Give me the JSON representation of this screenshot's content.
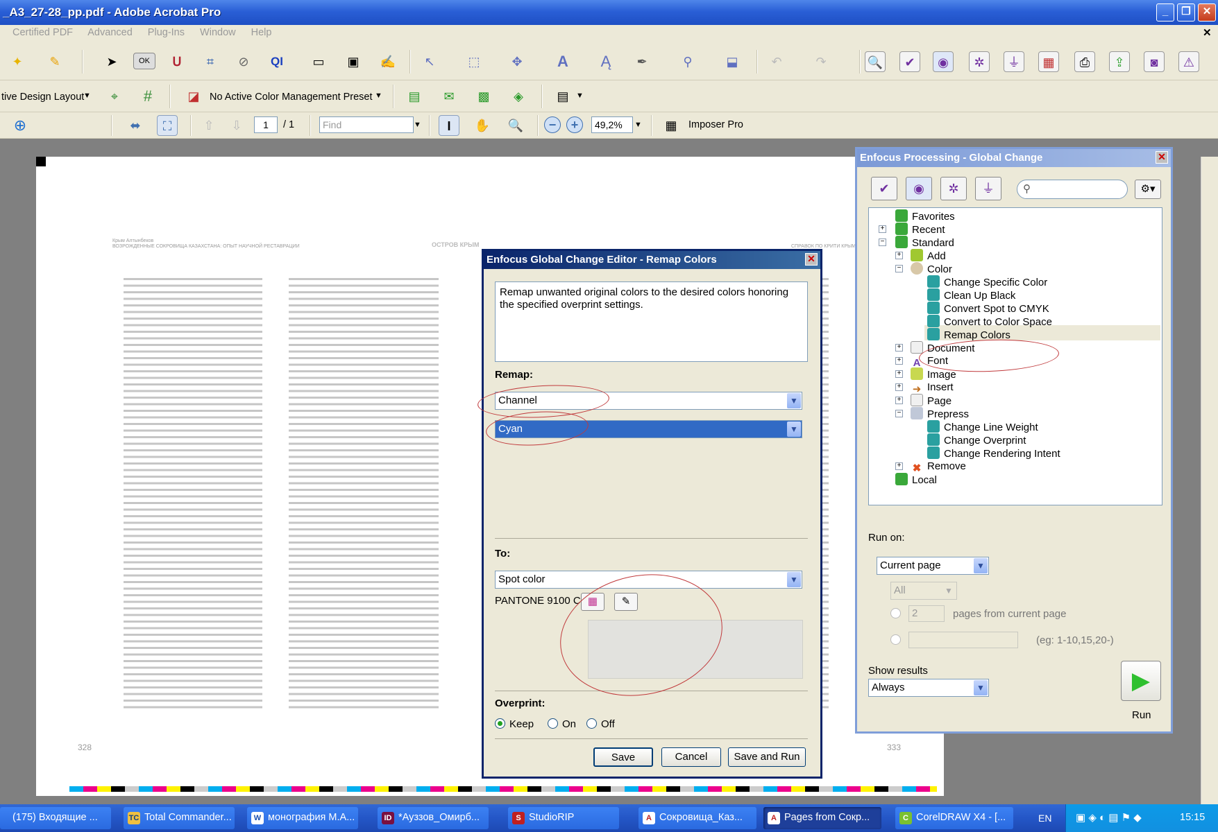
{
  "window": {
    "title": "_A3_27-28_pp.pdf - Adobe Acrobat Pro",
    "min": "_",
    "max": "❐",
    "close": "✕",
    "doc_close": "✕"
  },
  "menu": [
    "Certified PDF",
    "Advanced",
    "Plug-Ins",
    "Window",
    "Help"
  ],
  "toolbar2": {
    "design_layout": "tive Design Layout",
    "color_preset": "No Active Color Management Preset"
  },
  "toolbar3": {
    "page_value": "1",
    "page_total": "/ 1",
    "find_placeholder": "Find",
    "zoom": "49,2%",
    "imposer": "Imposer Pro"
  },
  "document": {
    "left_header_author": "Крым Алтынбеков",
    "left_header_title": "ВОЗРОЖДЕННЫЕ СОКРОВИЩА КАЗАХСТАНА: ОПЫТ НАУЧНОЙ РЕСТАВРАЦИИ",
    "logo_text": "ОСТРОВ КРЫМ",
    "right_header": "СПРАВОК ПО КРИТИ КРЫМУ",
    "page_left": "328",
    "page_right": "333"
  },
  "editor": {
    "title": "Enfocus Global Change Editor - Remap Colors",
    "description": "Remap unwanted original colors to the desired colors honoring the specified overprint settings.",
    "remap_label": "Remap:",
    "remap_mode": "Channel",
    "remap_channel": "Cyan",
    "to_label": "To:",
    "to_type": "Spot color",
    "spot_name": "PANTONE 9100 C",
    "overprint_label": "Overprint:",
    "overprint_options": [
      "Keep",
      "On",
      "Off"
    ],
    "save": "Save",
    "cancel": "Cancel",
    "save_run": "Save and Run"
  },
  "processing": {
    "title": "Enfocus Processing - Global Change",
    "tree": {
      "favorites": "Favorites",
      "recent": "Recent",
      "standard": "Standard",
      "add": "Add",
      "color": "Color",
      "change_specific": "Change Specific Color",
      "clean_black": "Clean Up Black",
      "spot_cmyk": "Convert Spot to CMYK",
      "color_space": "Convert to Color Space",
      "remap": "Remap Colors",
      "document": "Document",
      "font": "Font",
      "image": "Image",
      "insert": "Insert",
      "page": "Page",
      "prepress": "Prepress",
      "line_weight": "Change Line Weight",
      "overprint": "Change Overprint",
      "rendering": "Change Rendering Intent",
      "remove": "Remove",
      "local": "Local"
    },
    "run_on_label": "Run on:",
    "run_on": "Current page",
    "all": "All",
    "pages_count": "2",
    "pages_from": "pages from current page",
    "range_hint": "(eg: 1-10,15,20-)",
    "show_results_label": "Show results",
    "show_results": "Always",
    "run": "Run"
  },
  "taskbar": [
    {
      "label": "(175) Входящие ...",
      "icon": "✉"
    },
    {
      "label": "Total Commander...",
      "icon": "TC"
    },
    {
      "label": "монография М.А...",
      "icon": "W"
    },
    {
      "label": "*Ауззов_Омирб...",
      "icon": "ID"
    },
    {
      "label": "StudioRIP",
      "icon": "S"
    },
    {
      "label": "Сокровища_Каз...",
      "icon": "A"
    },
    {
      "label": "Pages from Сокр...",
      "icon": "A"
    },
    {
      "label": "CorelDRAW X4 - [...",
      "icon": "C"
    }
  ],
  "tray": {
    "lang": "EN",
    "time": "15:15"
  },
  "colors": {
    "xp_blue": "#2456c7",
    "dialog_title": "#0a246a",
    "selection": "#316ac5",
    "annotation_red": "#c0393b"
  }
}
